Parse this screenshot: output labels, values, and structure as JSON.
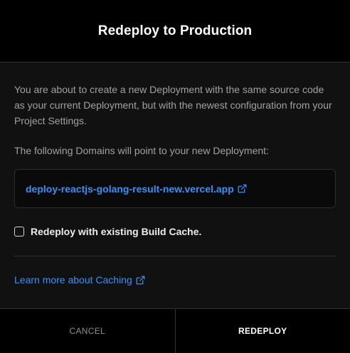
{
  "dialog": {
    "title": "Redeploy to Production",
    "description": "You are about to create a new Deployment with the same source code as your current Deployment, but with the newest configuration from your Project Settings.",
    "domains_label": "The following Domains will point to your new Deployment:",
    "domains": [
      {
        "url": "deploy-reactjs-golang-result-new.vercel.app",
        "icon": "external-link-icon"
      }
    ],
    "build_cache": {
      "label": "Redeploy with existing Build Cache.",
      "checked": false
    },
    "learn_more": {
      "label": "Learn more about Caching",
      "icon": "external-link-icon"
    },
    "footer": {
      "cancel_label": "CANCEL",
      "redeploy_label": "REDEPLOY"
    }
  },
  "colors": {
    "background": "#111111",
    "header_footer": "#000000",
    "link": "#3b8ff6",
    "muted_text": "#a1a1a1",
    "border": "#333333"
  }
}
